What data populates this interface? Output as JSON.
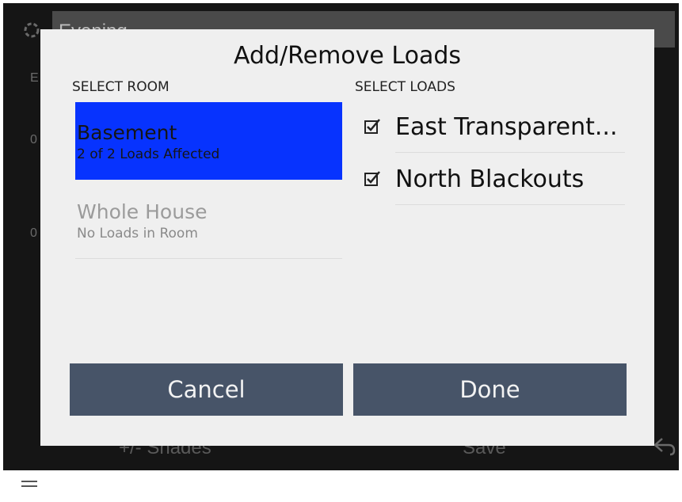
{
  "background": {
    "header_title": "Evening",
    "side_labels": [
      "E",
      "0",
      "0"
    ],
    "bottom_left_label": "+/- Shades",
    "bottom_right_label": "Save"
  },
  "modal": {
    "title": "Add/Remove Loads",
    "select_room_label": "SELECT ROOM",
    "select_loads_label": "SELECT LOADS",
    "rooms": [
      {
        "name": "Basement",
        "subtitle": "2 of 2 Loads Affected",
        "selected": true
      },
      {
        "name": "Whole House",
        "subtitle": "No Loads in Room",
        "selected": false
      }
    ],
    "loads": [
      {
        "label": "East Transparent...",
        "checked": true
      },
      {
        "label": "North Blackouts",
        "checked": true
      }
    ],
    "cancel_label": "Cancel",
    "done_label": "Done"
  },
  "colors": {
    "selected_room": "#0733fe",
    "button_bg": "#475468",
    "modal_bg": "#efefef",
    "app_bg": "#151515"
  },
  "icons": [
    "settings-icon",
    "back-arrow-icon",
    "menu-icon",
    "checkbox-checked-icon"
  ]
}
